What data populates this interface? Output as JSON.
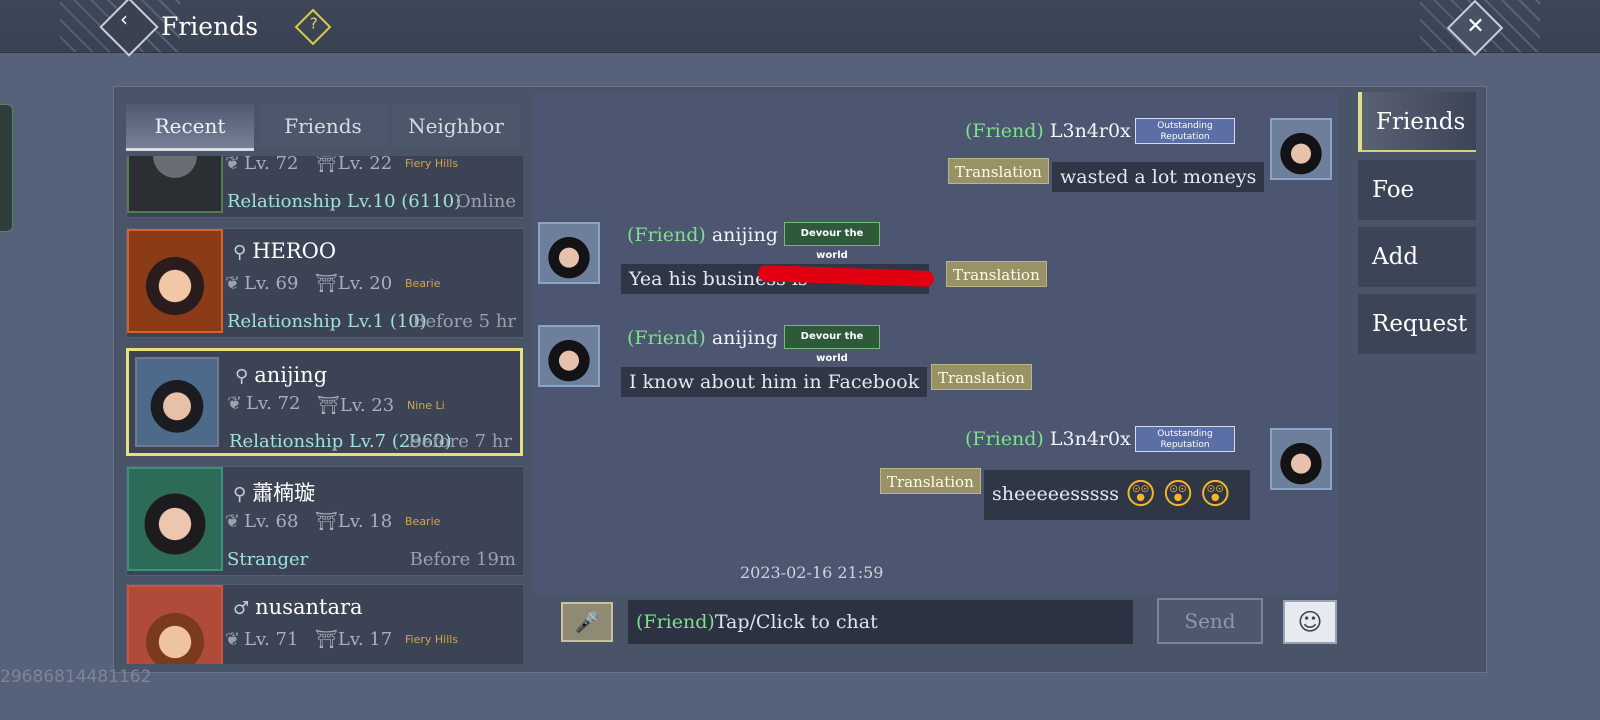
{
  "header": {
    "title": "Friends",
    "help_glyph": "?",
    "back_glyph": "‹",
    "close_glyph": "✕"
  },
  "tabs": [
    {
      "label": "Recent",
      "active": true
    },
    {
      "label": "Friends",
      "active": false
    },
    {
      "label": "Neighbor",
      "active": false
    }
  ],
  "contacts": [
    {
      "name": "",
      "gender_icon": "",
      "level": "Lv. 72",
      "level2": "Lv. 22",
      "server": "Fiery Hills",
      "relationship": "Relationship Lv.10 (6110)",
      "status": "Online",
      "avatar_style": "wolf"
    },
    {
      "name": "HEROO",
      "gender_icon": "female-icon",
      "level": "Lv. 69",
      "level2": "Lv. 20",
      "server": "Bearie",
      "relationship": "Relationship Lv.1 (10)",
      "status": "Before 5 hr",
      "avatar_style": "fire"
    },
    {
      "name": "anijing",
      "gender_icon": "female-icon",
      "level": "Lv. 72",
      "level2": "Lv. 23",
      "server": "Nine Li",
      "relationship": "Relationship Lv.7 (2960)",
      "status": "Before 7 hr",
      "avatar_style": "blue",
      "selected": true
    },
    {
      "name": "蕭楠璇",
      "gender_icon": "female-icon",
      "level": "Lv. 68",
      "level2": "Lv. 18",
      "server": "Bearie",
      "relationship": "Stranger",
      "status": "Before 19m",
      "avatar_style": "green"
    },
    {
      "name": "nusantara",
      "gender_icon": "male-icon",
      "level": "Lv. 71",
      "level2": "Lv. 17",
      "server": "Fiery Hills",
      "relationship": "",
      "status": "",
      "avatar_style": "red"
    }
  ],
  "chat": {
    "friend_prefix": "(Friend)",
    "translation_label": "Translation",
    "messages": [
      {
        "sender": "L3n4r0x",
        "side": "right",
        "badge": "Outstanding Reputation",
        "text": "wasted a lot moneys"
      },
      {
        "sender": "anijing",
        "side": "left",
        "badge": "Devour the world",
        "text": "Yea his business is"
      },
      {
        "sender": "anijing",
        "side": "left",
        "badge": "Devour the world",
        "text": "I know about him in Facebook"
      },
      {
        "sender": "L3n4r0x",
        "side": "right",
        "badge": "Outstanding Reputation",
        "text": "sheeeeesssss"
      }
    ],
    "timestamp": "2023-02-16  21:59",
    "input_prefix": "(Friend)",
    "input_placeholder": "Tap/Click to chat",
    "send_label": "Send"
  },
  "right_nav": [
    {
      "label": "Friends",
      "active": true
    },
    {
      "label": "Foe",
      "active": false
    },
    {
      "label": "Add",
      "active": false
    },
    {
      "label": "Request",
      "active": false
    }
  ],
  "footer": {
    "uid": "29686814481162"
  },
  "colors": {
    "accent_green": "#7ee08d",
    "relationship_teal": "#9ee3d7",
    "highlight_yellow": "#e8e07a"
  }
}
